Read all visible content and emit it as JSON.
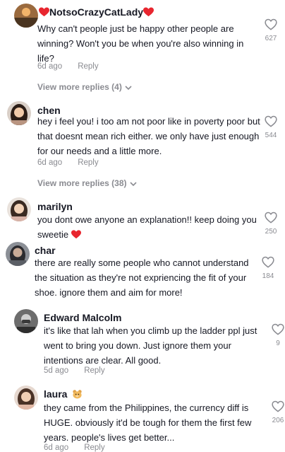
{
  "comments": [
    {
      "username": "NotsoCrazyCatLady",
      "text": "Why can't people just be happy other people are winning? Won't you be when you're also winning in life?",
      "time": "6d ago",
      "reply": "Reply",
      "likes": "627",
      "view_more": "View more replies (4)"
    },
    {
      "username": "chen",
      "text": "hey i feel you! i too am not poor like in poverty poor but that doesnt mean rich either. we only have just enough for our needs and a little more.",
      "time": "6d ago",
      "reply": "Reply",
      "likes": "544",
      "view_more": "View more replies (38)"
    },
    {
      "username": "marilyn",
      "text": "you dont owe anyone an explanation!! keep doing you sweetie",
      "likes": "250"
    },
    {
      "username": "char",
      "text": "there are really some people who cannot understand the situation as they're not expriencing the fit of your shoe. ignore them and aim for more!",
      "likes": "184"
    },
    {
      "username": "Edward Malcolm",
      "text": "it's like that lah when you climb up the ladder ppl just went to bring you down. Just ignore them your intentions are clear. All good.",
      "time": "5d ago",
      "reply": "Reply",
      "likes": "9"
    },
    {
      "username": "laura",
      "text": "they came from the Philippines, the currency diff is HUGE. obviously it'd be tough for them the first few years. people's lives get better...",
      "time": "6d ago",
      "reply": "Reply",
      "likes": "206"
    }
  ],
  "colors": {
    "text": "#161823",
    "secondary": "#8a8b91",
    "heart_emoji": "#e8262f"
  }
}
